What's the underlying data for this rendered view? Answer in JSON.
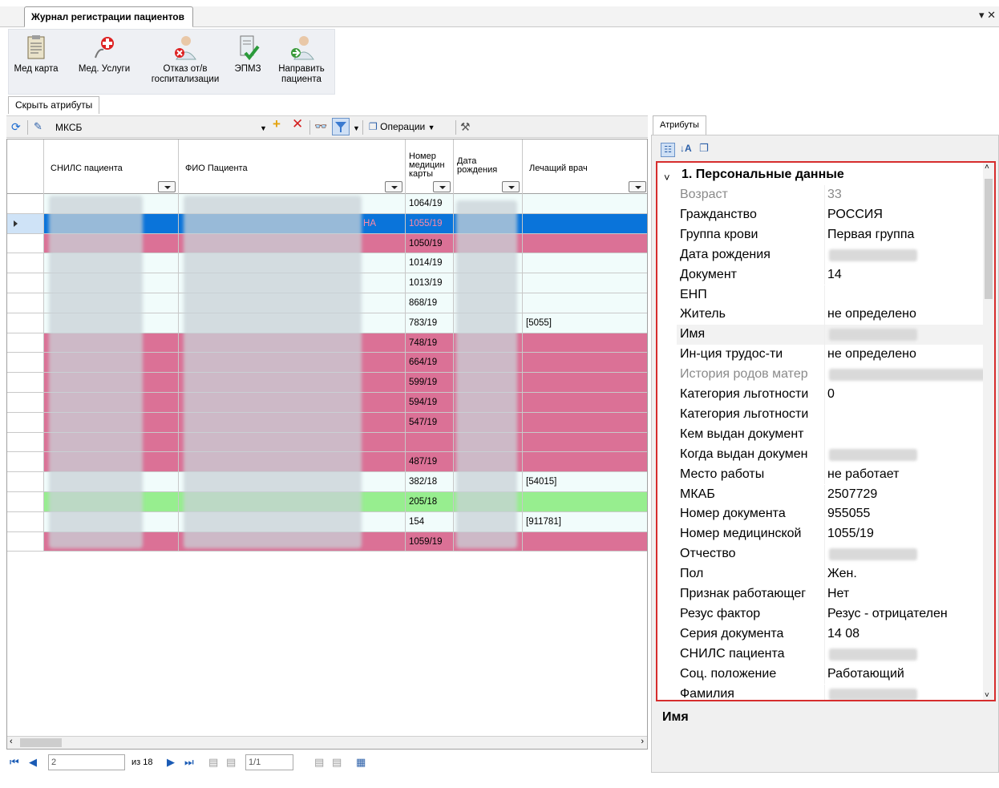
{
  "window": {
    "tab_title": "Журнал регистрации пациентов",
    "controls": "▾ ✕"
  },
  "ribbon": {
    "buttons": [
      {
        "label": "Мед карта",
        "icon": "medical-card-icon"
      },
      {
        "label": "Мед. Услуги",
        "icon": "medical-services-icon"
      },
      {
        "label": "Отказ от/в госпитализации",
        "icon": "refuse-hospitalization-icon"
      },
      {
        "label": "ЭПМЗ",
        "icon": "epmz-icon"
      },
      {
        "label": "Направить пациента",
        "icon": "refer-patient-icon"
      }
    ]
  },
  "attr_toggle": "Скрыть атрибуты",
  "toolbar": {
    "filter_name": "МКСБ",
    "operations_label": "Операции"
  },
  "grid": {
    "columns": [
      "СНИЛС пациента",
      "ФИО Пациента",
      "Номер медицин карты",
      "Дата рождения",
      "Лечащий врач"
    ],
    "rows": [
      {
        "color": "white",
        "card": "1064/19",
        "doctor": ""
      },
      {
        "color": "blue",
        "card": "1055/19",
        "doctor": "",
        "fio_tail": "НА"
      },
      {
        "color": "pink",
        "card": "1050/19",
        "doctor": ""
      },
      {
        "color": "white",
        "card": "1014/19",
        "doctor": ""
      },
      {
        "color": "white",
        "card": "1013/19",
        "doctor": ""
      },
      {
        "color": "white",
        "card": "868/19",
        "doctor": ""
      },
      {
        "color": "white",
        "card": "783/19",
        "doctor": "[5055]"
      },
      {
        "color": "pink",
        "card": "748/19",
        "doctor": ""
      },
      {
        "color": "pink",
        "card": "664/19",
        "doctor": ""
      },
      {
        "color": "pink",
        "card": "599/19",
        "doctor": ""
      },
      {
        "color": "pink",
        "card": "594/19",
        "doctor": ""
      },
      {
        "color": "pink",
        "card": "547/19",
        "doctor": ""
      },
      {
        "color": "pink",
        "card": "",
        "doctor": ""
      },
      {
        "color": "pink",
        "card": "487/19",
        "doctor": ""
      },
      {
        "color": "white",
        "card": "382/18",
        "doctor": "[54015]"
      },
      {
        "color": "green",
        "card": "205/18",
        "doctor": ""
      },
      {
        "color": "white",
        "card": "154",
        "doctor": "[911781]"
      },
      {
        "color": "pink",
        "card": "1059/19",
        "doctor": ""
      }
    ]
  },
  "navigator": {
    "page_input": "2",
    "of_total": "из 18",
    "page_box": "1/1"
  },
  "attributes": {
    "tab_label": "Атрибуты",
    "category": "1. Персональные данные",
    "props": [
      {
        "name": "Возраст",
        "value": "33",
        "dim": true
      },
      {
        "name": "Гражданство",
        "value": "РОССИЯ"
      },
      {
        "name": "Группа крови",
        "value": "Первая группа"
      },
      {
        "name": "Дата рождения",
        "value": "",
        "blur": true
      },
      {
        "name": "Документ",
        "value": "14"
      },
      {
        "name": "ЕНП",
        "value": ""
      },
      {
        "name": "Житель",
        "value": "не определено"
      },
      {
        "name": "Имя",
        "value": "",
        "blur": true,
        "selected": true
      },
      {
        "name": "Ин-ция трудос-ти",
        "value": "не определено"
      },
      {
        "name": "История родов матер",
        "value": "",
        "dim": true,
        "blur": true
      },
      {
        "name": "Категория льготности",
        "value": "0"
      },
      {
        "name": "Категория льготности",
        "value": ""
      },
      {
        "name": "Кем выдан документ",
        "value": ""
      },
      {
        "name": "Когда выдан докумен",
        "value": "",
        "blur": true
      },
      {
        "name": "Место работы",
        "value": "не работает"
      },
      {
        "name": "МКАБ",
        "value": "2507729"
      },
      {
        "name": "Номер документа",
        "value": "955055"
      },
      {
        "name": "Номер медицинской",
        "value": "1055/19"
      },
      {
        "name": "Отчество",
        "value": "",
        "blur": true
      },
      {
        "name": "Пол",
        "value": "Жен."
      },
      {
        "name": "Признак работающег",
        "value": "Нет"
      },
      {
        "name": "Резус фактор",
        "value": "Резус - отрицателен"
      },
      {
        "name": "Серия документа",
        "value": "14 08"
      },
      {
        "name": "СНИЛС пациента",
        "value": "",
        "blur": true
      },
      {
        "name": "Соц. положение",
        "value": "Работающий"
      },
      {
        "name": "Фамилия",
        "value": "",
        "blur": true
      }
    ],
    "description_title": "Имя"
  }
}
